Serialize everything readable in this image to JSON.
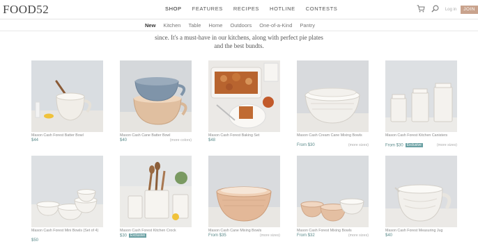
{
  "brand": {
    "logo": "FOOD52"
  },
  "main_nav": [
    {
      "label": "SHOP",
      "active": true
    },
    {
      "label": "FEATURES",
      "active": false
    },
    {
      "label": "RECIPES",
      "active": false
    },
    {
      "label": "HOTLINE",
      "active": false
    },
    {
      "label": "CONTESTS",
      "active": false
    }
  ],
  "tools": {
    "cart_icon": "cart-icon",
    "search_icon": "search-icon",
    "login_label": "Log in",
    "join_label": "JOIN"
  },
  "sub_nav": [
    {
      "label": "New",
      "active": true
    },
    {
      "label": "Kitchen",
      "active": false
    },
    {
      "label": "Table",
      "active": false
    },
    {
      "label": "Home",
      "active": false
    },
    {
      "label": "Outdoors",
      "active": false
    },
    {
      "label": "One-of-a-Kind",
      "active": false
    },
    {
      "label": "Pantry",
      "active": false
    }
  ],
  "intro": {
    "line1": "since. It's a must-have in our kitchens, along with perfect pie plates",
    "line2": "and the best bundts."
  },
  "products": [
    {
      "name": "Mason Cash Forest Batter Bowl",
      "price": "$44",
      "more": "",
      "badge": ""
    },
    {
      "name": "Mason Cash Cane Batter Bowl",
      "price": "$40",
      "more": "(more colors)",
      "badge": ""
    },
    {
      "name": "Mason Cash Forest Baking Set",
      "price": "$48",
      "more": "",
      "badge": ""
    },
    {
      "name": "Mason Cash Cream Cane Mixing Bowls",
      "price": "From $30",
      "more": "(more sizes)",
      "badge": ""
    },
    {
      "name": "Mason Cash Forest Kitchen Canisters",
      "price": "From $30",
      "more": "(more sizes)",
      "badge": "Exclusive"
    },
    {
      "name": "Mason Cash Forest Mini Bowls (Set of 4)",
      "price": "$50",
      "more": "",
      "badge": ""
    },
    {
      "name": "Mason Cash Forest Kitchen Crock",
      "price": "$30",
      "more": "",
      "badge": "Exclusive"
    },
    {
      "name": "Mason Cash Cane Mixing Bowls",
      "price": "From $35",
      "more": "(more sizes)",
      "badge": ""
    },
    {
      "name": "Mason Cash Forest Mixing Bowls",
      "price": "From $32",
      "more": "(more sizes)",
      "badge": ""
    },
    {
      "name": "Mason Cash Forest Measuring Jug",
      "price": "$40",
      "more": "",
      "badge": ""
    }
  ],
  "colors": {
    "price": "#5a8a8a",
    "badge": "#6aa0a3",
    "join": "#c9a38d"
  }
}
